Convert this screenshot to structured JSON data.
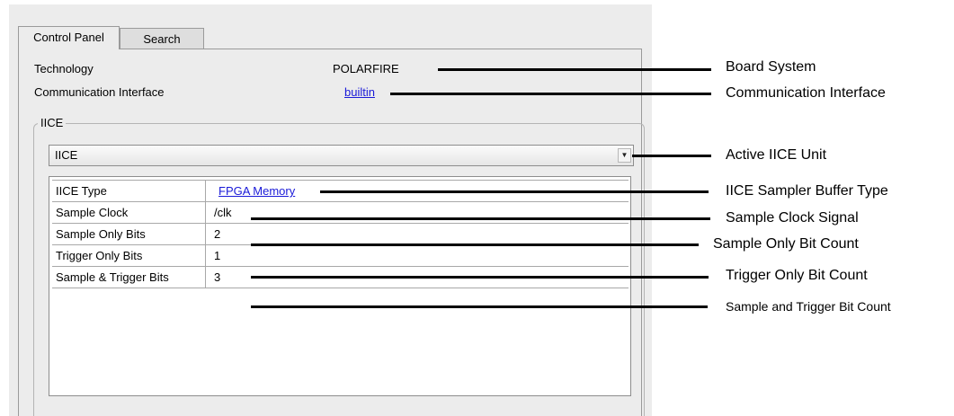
{
  "tabs": [
    "Control Panel",
    "Search"
  ],
  "info": {
    "technology_label": "Technology",
    "technology_value": "POLARFIRE",
    "comm_label": "Communication Interface",
    "comm_value": "builtin"
  },
  "group": {
    "title": "IICE",
    "selected_unit": "IICE"
  },
  "properties": [
    {
      "name": "IICE Type",
      "value": "FPGA Memory"
    },
    {
      "name": "Sample Clock",
      "value": "/clk"
    },
    {
      "name": "Sample Only Bits",
      "value": "2"
    },
    {
      "name": "Trigger Only Bits",
      "value": "1"
    },
    {
      "name": "Sample & Trigger Bits",
      "value": "3"
    }
  ],
  "callouts": [
    "Board System",
    "Communication Interface",
    "Active IICE Unit",
    "IICE Sampler Buffer Type",
    "Sample Clock Signal",
    "Sample Only Bit Count",
    "Trigger Only Bit Count",
    "Sample and Trigger Bit Count"
  ],
  "icons": {
    "dropdown": "chevron-down-icon"
  }
}
